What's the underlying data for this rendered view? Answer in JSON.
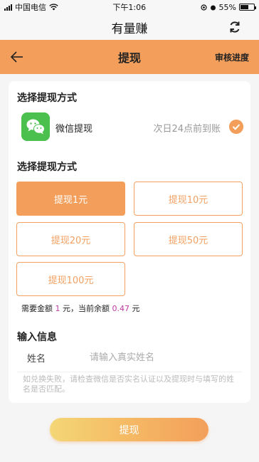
{
  "status_bar": {
    "carrier": "中国电信",
    "time": "下午1:06",
    "battery": "55%"
  },
  "app_bar": {
    "title": "有量赚",
    "refresh_icon": "refresh-icon"
  },
  "header": {
    "title": "提现",
    "back_icon": "arrow-left-icon",
    "audit_label": "审核进度",
    "color": "#f39f5b"
  },
  "method_section": {
    "title": "选择提现方式",
    "wechat_label": "微信提现",
    "wechat_note": "次日24点前到账",
    "selected": true
  },
  "amount_section": {
    "title": "选择提现方式",
    "options": [
      "提现1元",
      "提现10元",
      "提现20元",
      "提现50元",
      "提现100元"
    ],
    "selected_index": 0
  },
  "balance": {
    "prefix": "需要金额",
    "required": "1",
    "middle": "元，当前余额",
    "current": "0.47",
    "suffix": "元"
  },
  "input_section": {
    "title": "输入信息",
    "name_label": "姓名",
    "name_placeholder": "请输入真实姓名",
    "name_value": "",
    "hint": "如兑换失败，请检查微信是否实名认证以及提现时与填写的姓名是否匹配。"
  },
  "submit": {
    "label": "提现"
  }
}
